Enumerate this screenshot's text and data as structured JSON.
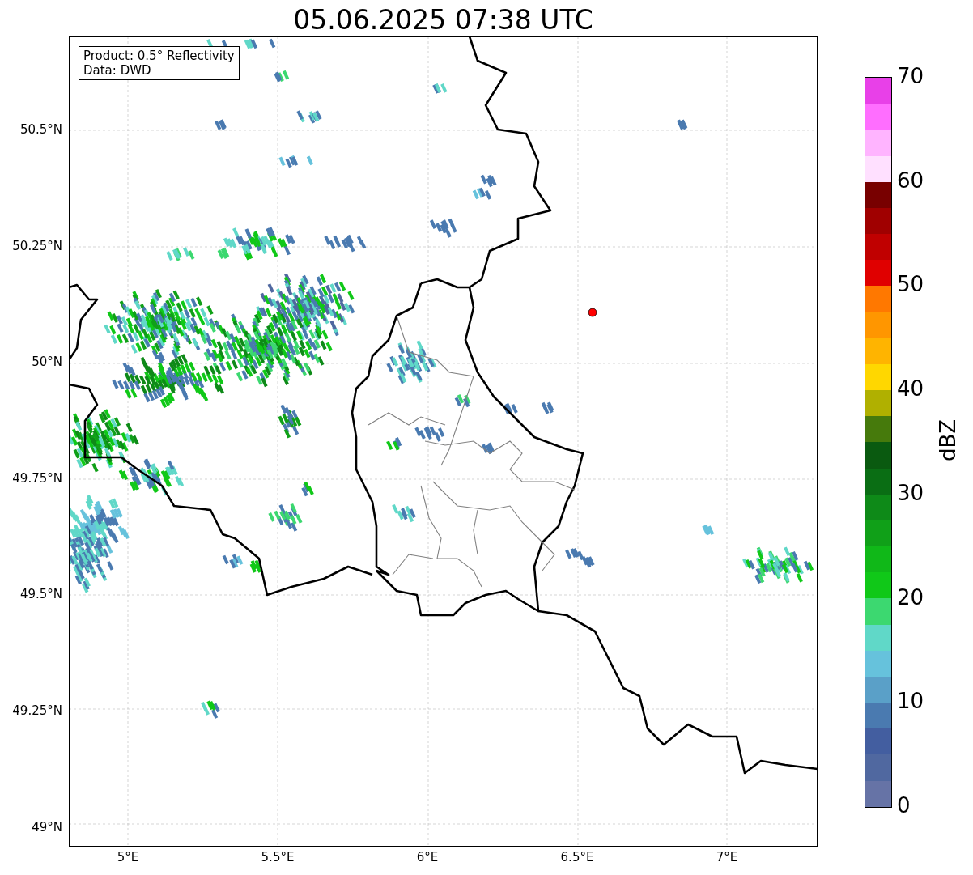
{
  "title": "05.06.2025 07:38 UTC",
  "info_box": {
    "lines": [
      "Product: 0.5° Reflectivity",
      "Data: DWD"
    ]
  },
  "y_ticks": [
    "50.5°N",
    "50.25°N",
    "50°N",
    "49.75°N",
    "49.5°N",
    "49.25°N",
    "49°N"
  ],
  "x_ticks": [
    "5°E",
    "5.5°E",
    "6°E",
    "6.5°E",
    "7°E"
  ],
  "colorbar": {
    "label": "dBZ",
    "ticks": [
      "70",
      "60",
      "50",
      "40",
      "30",
      "20",
      "10",
      "0"
    ],
    "bands": [
      {
        "color": "#e840e8"
      },
      {
        "color": "#ff6eff"
      },
      {
        "color": "#ffb4ff"
      },
      {
        "color": "#ffe0ff"
      },
      {
        "color": "#780000"
      },
      {
        "color": "#a00000"
      },
      {
        "color": "#c00000"
      },
      {
        "color": "#e00000"
      },
      {
        "color": "#ff7800"
      },
      {
        "color": "#ff9600"
      },
      {
        "color": "#ffb400"
      },
      {
        "color": "#ffd700"
      },
      {
        "color": "#b0b000"
      },
      {
        "color": "#467a0c"
      },
      {
        "color": "#0a5a10"
      },
      {
        "color": "#0a6e14"
      },
      {
        "color": "#0e8a18"
      },
      {
        "color": "#10a018"
      },
      {
        "color": "#10b818"
      },
      {
        "color": "#10c818"
      },
      {
        "color": "#3cd870"
      },
      {
        "color": "#60d8c8"
      },
      {
        "color": "#66c2dc"
      },
      {
        "color": "#5aa0c8"
      },
      {
        "color": "#4a7ab0"
      },
      {
        "color": "#435ea0"
      },
      {
        "color": "#5068a0"
      },
      {
        "color": "#6673a6"
      }
    ]
  }
}
